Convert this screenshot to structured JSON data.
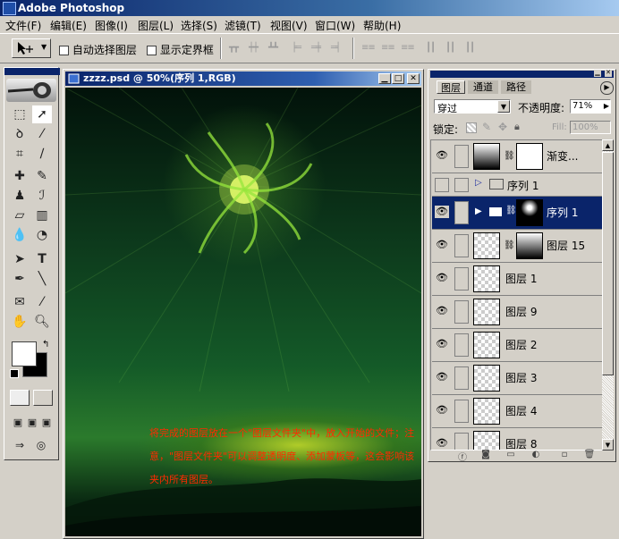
{
  "app": {
    "title": "Adobe Photoshop"
  },
  "menu": {
    "items": [
      "文件(F)",
      "编辑(E)",
      "图像(I)",
      "图层(L)",
      "选择(S)",
      "滤镜(T)",
      "视图(V)",
      "窗口(W)",
      "帮助(H)"
    ]
  },
  "options": {
    "auto_select_label": "自动选择图层",
    "show_bounds_label": "显示定界框",
    "auto_select_checked": false,
    "show_bounds_checked": false
  },
  "document": {
    "title": "zzzz.psd @ 50%(序列 1,RGB)",
    "annotation": "将完成的图层放在一个\"图层文件夹\"中，放入开始的文件；注意，\"图层文件夹\"可以调整透明度、添加蒙板等，这会影响该夹内所有图层。"
  },
  "colors": {
    "foreground": "#ffffff",
    "background": "#000000",
    "selection": "#0a246a",
    "annotation": "#ff2a00"
  },
  "layers_panel": {
    "tabs": [
      "图层",
      "通道",
      "路径"
    ],
    "blend_mode": "穿过",
    "opacity_label": "不透明度:",
    "opacity_value": "71%",
    "lock_label": "锁定:",
    "fill_label": "Fill:",
    "fill_value": "100%",
    "layers": [
      {
        "name": "渐变...",
        "visible": true,
        "kind": "adjustment"
      },
      {
        "name": "序列 1",
        "visible": false,
        "kind": "group"
      },
      {
        "name": "序列 1",
        "visible": true,
        "kind": "group-selected"
      },
      {
        "name": "图层 15",
        "visible": true,
        "kind": "masked"
      },
      {
        "name": "图层 1",
        "visible": true,
        "kind": "layer"
      },
      {
        "name": "图层 9",
        "visible": true,
        "kind": "layer"
      },
      {
        "name": "图层 2",
        "visible": true,
        "kind": "layer"
      },
      {
        "name": "图层 3",
        "visible": true,
        "kind": "layer"
      },
      {
        "name": "图层 4",
        "visible": true,
        "kind": "layer"
      },
      {
        "name": "图层 8",
        "visible": true,
        "kind": "layer"
      }
    ]
  },
  "icons": {
    "eye": "eye-icon",
    "folder": "folder-icon",
    "chain": "chain-link-icon",
    "triangle": "expand-triangle-icon"
  }
}
